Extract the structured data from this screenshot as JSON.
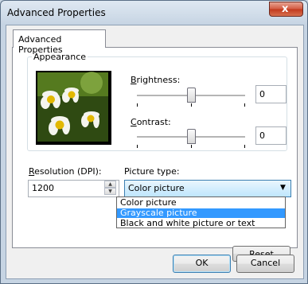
{
  "window": {
    "title": "Advanced Properties",
    "close_glyph": "x"
  },
  "tab": {
    "label": "Advanced Properties"
  },
  "appearance": {
    "group_label": "Appearance",
    "brightness": {
      "label_key": "B",
      "label_rest": "rightness:",
      "value": "0",
      "level": 0.5
    },
    "contrast": {
      "label_key": "C",
      "label_rest": "ontrast:",
      "value": "0",
      "level": 0.5
    }
  },
  "resolution": {
    "label_key": "R",
    "label_rest": "esolution (DPI):",
    "value": "1200"
  },
  "picture_type": {
    "label": "Picture type:",
    "selected": "Color picture",
    "options": [
      "Color picture",
      "Grayscale picture",
      "Black and white picture or text"
    ],
    "highlighted_index": 1
  },
  "buttons": {
    "reset_visible": "Reset",
    "ok": "OK",
    "cancel": "Cancel"
  },
  "colors": {
    "highlight": "#3399ff",
    "accent": "#3c7fb1"
  }
}
